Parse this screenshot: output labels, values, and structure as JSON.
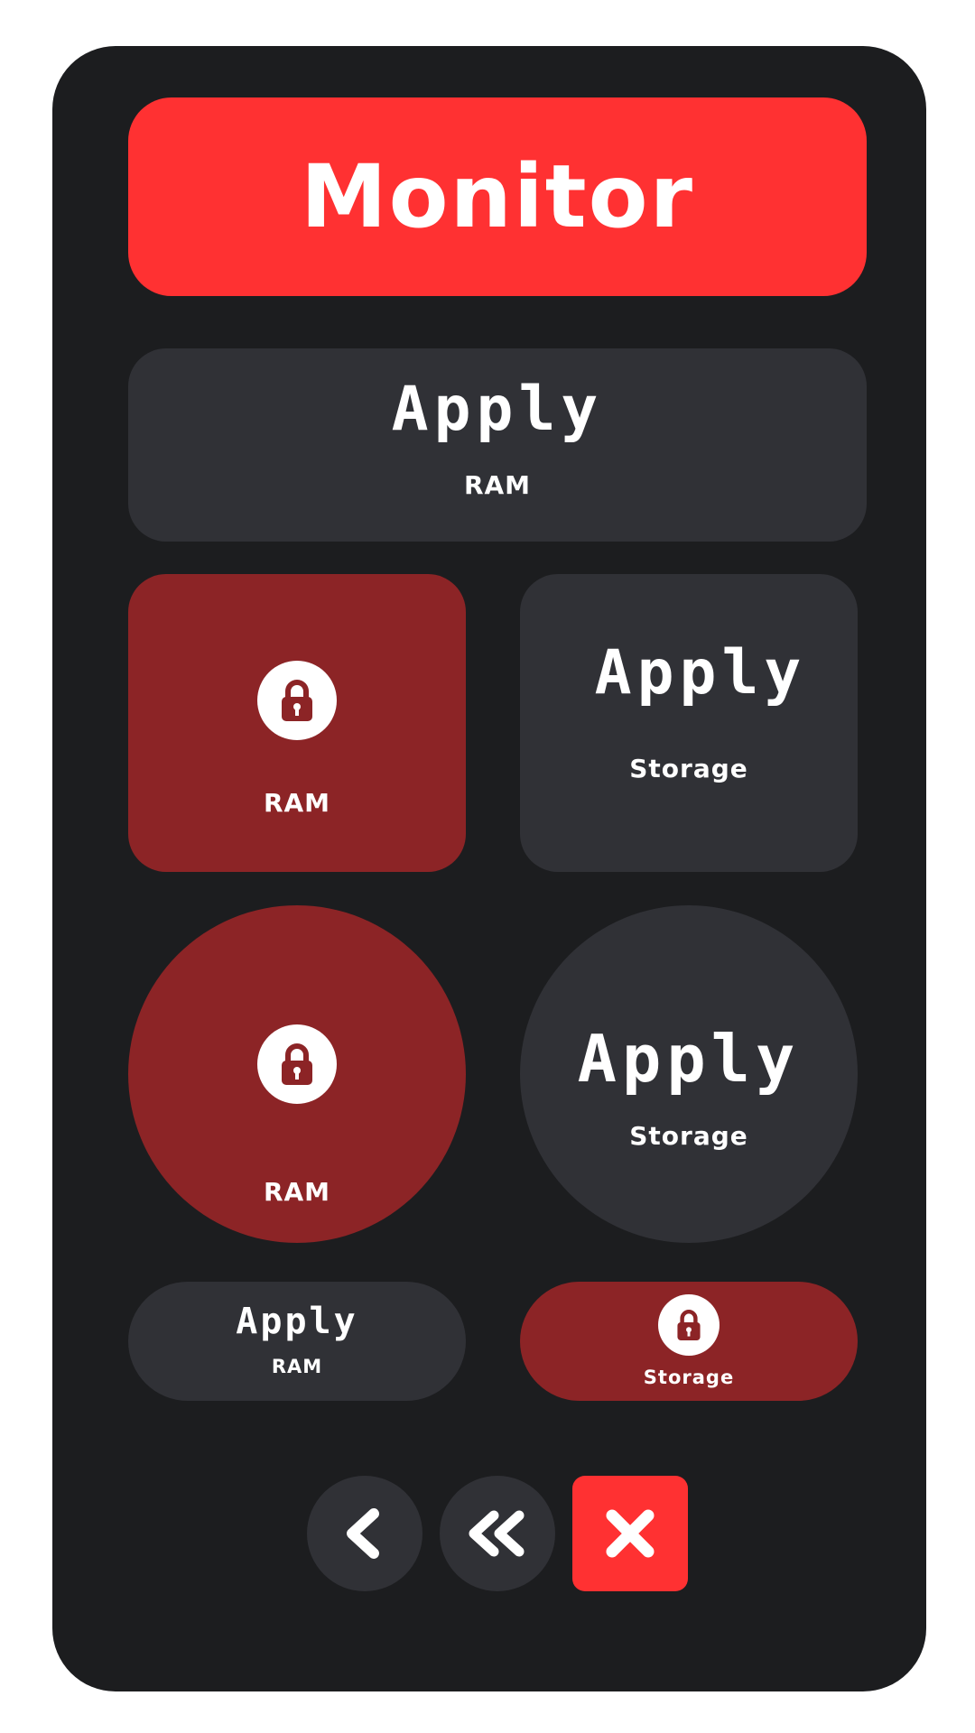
{
  "header": {
    "title": "Monitor"
  },
  "tiles": {
    "wide_apply": {
      "value": "Apply",
      "label": "RAM"
    },
    "square_ram": {
      "icon": "lock-icon",
      "label": "RAM"
    },
    "square_storage": {
      "value": "Apply",
      "label": "Storage"
    },
    "circle_ram": {
      "icon": "lock-icon",
      "label": "RAM"
    },
    "circle_storage": {
      "value": "Apply",
      "label": "Storage"
    },
    "pill_ram": {
      "value": "Apply",
      "label": "RAM"
    },
    "pill_storage": {
      "icon": "lock-icon",
      "label": "Storage"
    }
  },
  "nav": {
    "back_icon": "chevron-left-icon",
    "back_all_icon": "double-chevron-left-icon",
    "close_icon": "close-icon"
  },
  "colors": {
    "panel": "#1c1d1f",
    "accent": "#ff3132",
    "tile_dark": "#303136",
    "tile_red": "#8c2426"
  }
}
